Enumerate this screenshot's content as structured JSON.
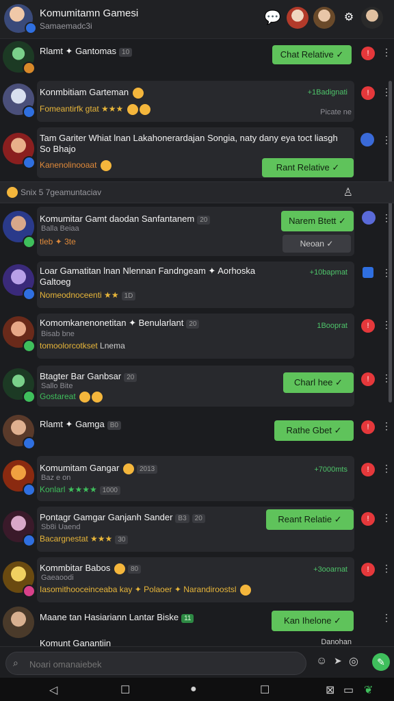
{
  "header": {
    "title": "Komumitamn Gamesi",
    "subtitle": "Samaemadc3i"
  },
  "section": {
    "label": "Snix 5 7geamuntaciav"
  },
  "rows": [
    {
      "name": "Rlamt ✦ Gantomas",
      "chip": "10",
      "pill": "Chat Relative"
    },
    {
      "name": "Konmbitiam Garteman",
      "line2": "Fomeantirfk gtat ★★★",
      "right": "+1Badignati",
      "right2": "Picate ne"
    },
    {
      "name": "Tam Gariter Whiat lnan Lakahonerardajan Songia, naty dany eya toct liasgh So Bhajo",
      "line2": "Kanenolinooaat",
      "pill": "Rant Relative"
    },
    {
      "name": "Komumitar Gamt daodan Sanfantanem",
      "chip": "20",
      "sub": "Balla Beiaa",
      "line2": "tleb ✦ 3te",
      "pill": "Narem Btett",
      "pill2": "Neoan"
    },
    {
      "name": "Loar Gamatitan lnan Nlennan Fandngeam ✦ Aorhoska Galtoeg",
      "line2": "Nomeodnoceenti ★★",
      "chip": "1D",
      "right": "+10bapmat"
    },
    {
      "name": "Komomkanenonetitan ✦ Benularlant",
      "chip": "20",
      "sub": "Bisab bne",
      "line2": "tomoolorcotkset",
      "line2b": "Lnema",
      "right": "1Booprat"
    },
    {
      "name": "Btagter Bar Ganbsar",
      "chip": "20",
      "sub": "Sallo Bite",
      "line2": "Gostareat",
      "pill": "Charl hee"
    },
    {
      "name": "Rlamt ✦ Gamga",
      "chip": "B0",
      "pill": "Rathe Gbet"
    },
    {
      "name": "Komumitam Gangar",
      "chip": "2013",
      "sub": "Baz e on",
      "line2": "Konlarl ★★★★",
      "chip2": "1000",
      "right": "+7000mts"
    },
    {
      "name": "Pontagr Gamgar Ganjanh Sander",
      "chip": "B3",
      "chip2": "20",
      "sub": "Sb8i Uaend",
      "line2": "Bacargnestat ★★★",
      "chip3": "30",
      "pill": "Reant Relatie"
    },
    {
      "name": "Kommbitar Babos",
      "chip": "80",
      "sub": "Gaeaoodi",
      "line2": "Iasomithooceinceaba kay ✦ Polaoer ✦ Narandiroostsl",
      "right": "+3ooarnat"
    },
    {
      "name": "Maane tan Hasiariann Lantar Biske",
      "chip": "11",
      "pill": "Kan Ihelone"
    },
    {
      "name": "Komunt Ganantiin",
      "right": "Danohan"
    }
  ],
  "composer": {
    "placeholder": "Noari omanaiebek"
  }
}
